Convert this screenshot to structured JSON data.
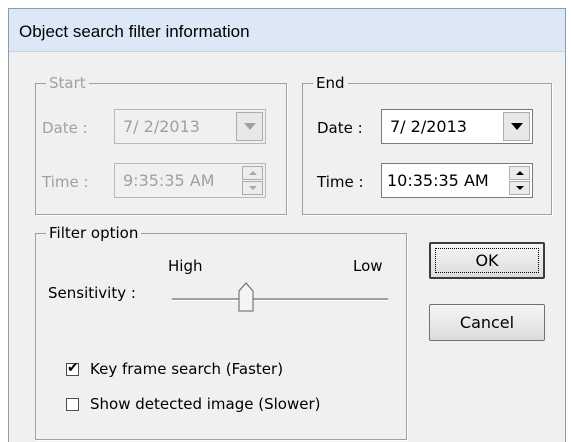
{
  "window": {
    "title": "Object search filter information"
  },
  "start": {
    "group_label": "Start",
    "date_label": "Date :",
    "date_value": "7/ 2/2013",
    "time_label": "Time :",
    "time_value": "9:35:35 AM",
    "enabled": false
  },
  "end": {
    "group_label": "End",
    "date_label": "Date :",
    "date_value": "7/ 2/2013",
    "time_label": "Time :",
    "time_value": "10:35:35 AM",
    "enabled": true
  },
  "filter": {
    "group_label": "Filter option",
    "sensitivity_label": "Sensitivity :",
    "high_label": "High",
    "low_label": "Low",
    "sensitivity_level_fraction": 0.33,
    "key_frame": {
      "label": "Key frame search (Faster)",
      "checked": true,
      "check_glyph": "✔"
    },
    "show_detected": {
      "label": "Show detected image (Slower)",
      "checked": false
    }
  },
  "buttons": {
    "ok": "OK",
    "cancel": "Cancel"
  },
  "colors": {
    "titlebar": "#dce8f5",
    "dialog": "#f0f0f0",
    "disabled_text": "#a0a0a0"
  }
}
